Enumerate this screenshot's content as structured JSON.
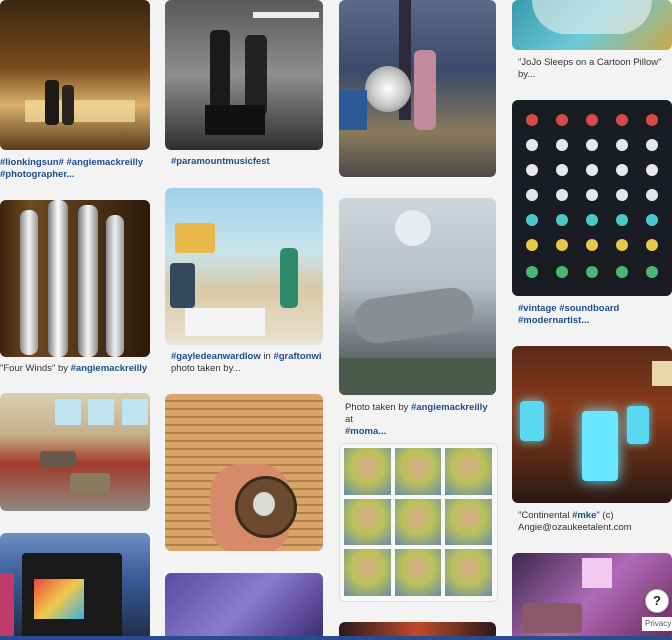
{
  "captions": {
    "c1": {
      "tag1": "#lionkingsun#",
      "tag2": "#angiemackreilly",
      "tag3": "#photographer..."
    },
    "c2": {
      "tag": "#paramountmusicfest"
    },
    "c3": {
      "pre": "\"JoJo Sleeps on a Cartoon Pillow\"",
      "post": "by..."
    },
    "c4": {
      "pre": "\"Four Winds\" by ",
      "tag": "#angiemackreilly"
    },
    "c5": {
      "tag1": "#gayledeanwardlow",
      "mid": " in ",
      "tag2": "#graftonwi",
      "post": "photo taken by..."
    },
    "c6": {
      "tag1": "#vintage",
      "tag2": "#soundboard",
      "tag3": "#modernartist..."
    },
    "c7": {
      "pre": "Photo taken by ",
      "tag1": "#angiemackreilly",
      "mid": " at",
      "tag2": "#moma..."
    },
    "c8": {
      "pre": "\"Continental ",
      "tag": "#mke",
      "post": "\" (c)",
      "line2": "Angie@ozaukeetalent.com"
    }
  },
  "widgets": {
    "help_label": "?",
    "privacy_label": "Privacy"
  },
  "colors": {
    "background": "#f3f3f3",
    "hashtag": "#1f4e8c",
    "bottom_bar": "#2a4b8d"
  }
}
